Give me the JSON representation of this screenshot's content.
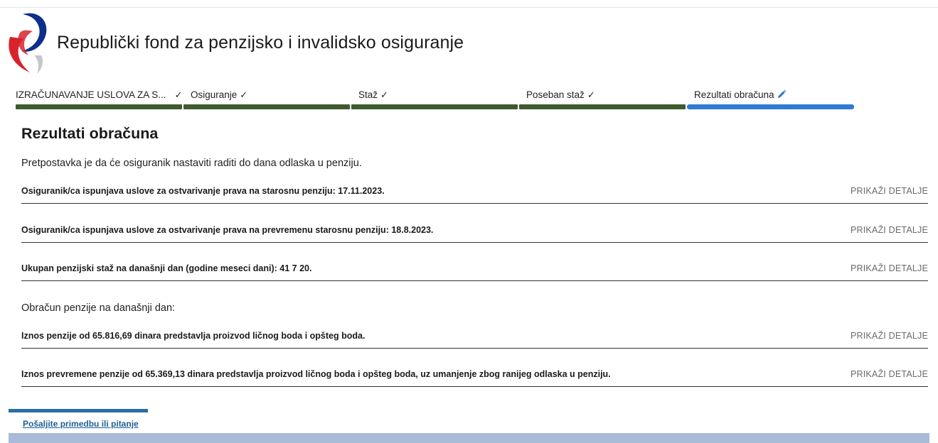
{
  "header": {
    "title": "Republički fond za penzijsko i invalidsko osiguranje",
    "logo_icon": "rfpio-logo-icon"
  },
  "steps": [
    {
      "label": "IZRAČUNAVANJE USLOVA ZA S...",
      "marker": "✓",
      "state": "done"
    },
    {
      "label": "Osiguranje",
      "marker": "✓",
      "state": "done"
    },
    {
      "label": "Staž",
      "marker": "✓",
      "state": "done"
    },
    {
      "label": "Poseban staž",
      "marker": "✓",
      "state": "done"
    },
    {
      "label": "Rezultati obračuna",
      "marker": "pencil-icon",
      "state": "active"
    }
  ],
  "main": {
    "heading": "Rezultati obračuna",
    "intro": "Pretpostavka je da će osiguranik nastaviti raditi do dana odlaska u penziju.",
    "section_label": "Obračun penzije na današnji dan:",
    "detail_link_label": "PRIKAŽI DETALJE",
    "results": [
      "Osiguranik/ca ispunjava uslove za ostvarivanje prava na starosnu penziju: 17.11.2023.",
      "Osiguranik/ca ispunjava uslove za ostvarivanje prava na prevremenu starosnu penziju: 18.8.2023.",
      "Ukupan penzijski staž na današnji dan (godine meseci dani): 41 7 20."
    ],
    "pension_results": [
      "Iznos penzije od 65.816,69 dinara predstavlja proizvod ličnog boda i opšteg boda.",
      "Iznos prevremene penzije od 65.369,13 dinara predstavlja proizvod ličnog boda i opšteg boda, uz umanjenje zbog ranijeg odlaska u penziju."
    ]
  },
  "footer": {
    "feedback_link": "Pošaljite primedbu ili pitanje"
  },
  "colors": {
    "step_done": "#3f5b2c",
    "step_active": "#2f7ad4",
    "footer_band": "#a9bbd9",
    "link": "#1f5f95"
  }
}
